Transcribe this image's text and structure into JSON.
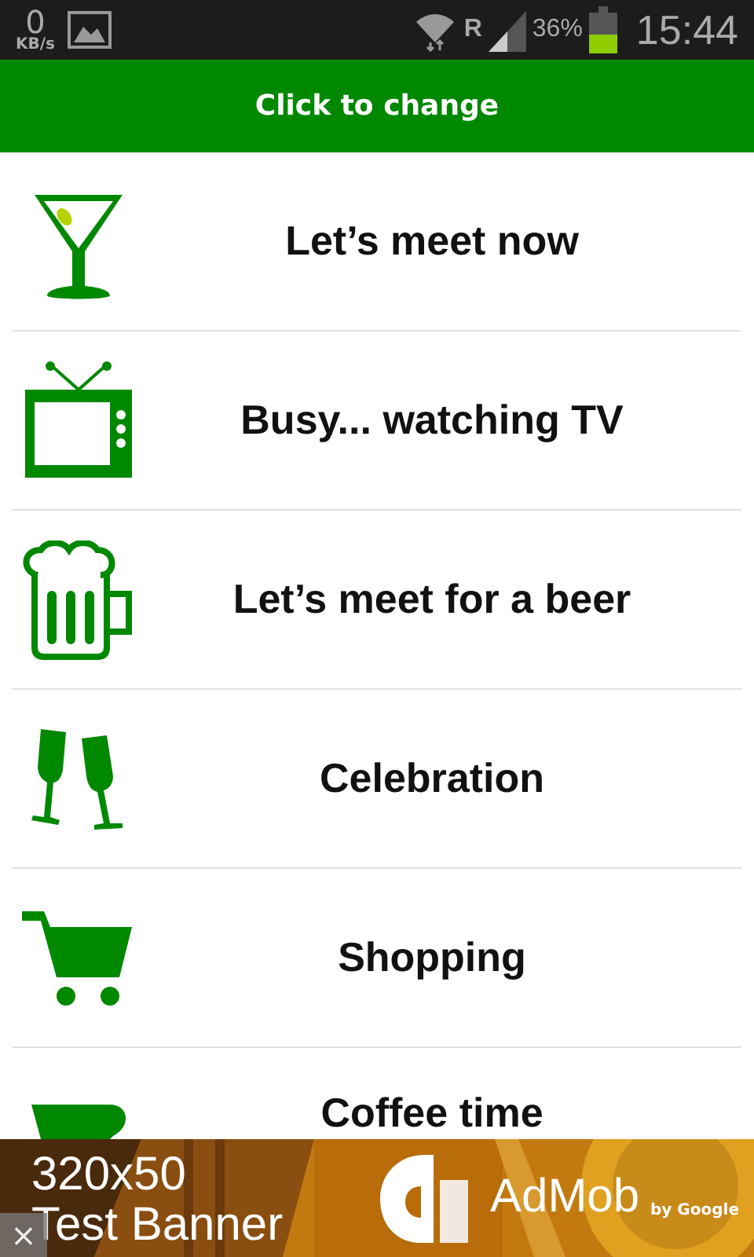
{
  "status_bar": {
    "speed": "0",
    "speed_unit": "KB/s",
    "battery_percent": "36%",
    "roaming": "R",
    "time": "15:44"
  },
  "header": {
    "title": "Click to change"
  },
  "items": [
    {
      "kind": "cocktail",
      "label": "Let’s meet now"
    },
    {
      "kind": "tv",
      "label": "Busy... watching TV"
    },
    {
      "kind": "beer",
      "label": "Let’s meet for a beer"
    },
    {
      "kind": "champagne",
      "label": "Celebration"
    },
    {
      "kind": "cart",
      "label": "Shopping"
    },
    {
      "kind": "coffee",
      "label": "Coffee time"
    }
  ],
  "ad_banner": {
    "size": "320x50",
    "title": "Test Banner",
    "brand": "AdMob",
    "byline": "by Google",
    "close": "×"
  }
}
